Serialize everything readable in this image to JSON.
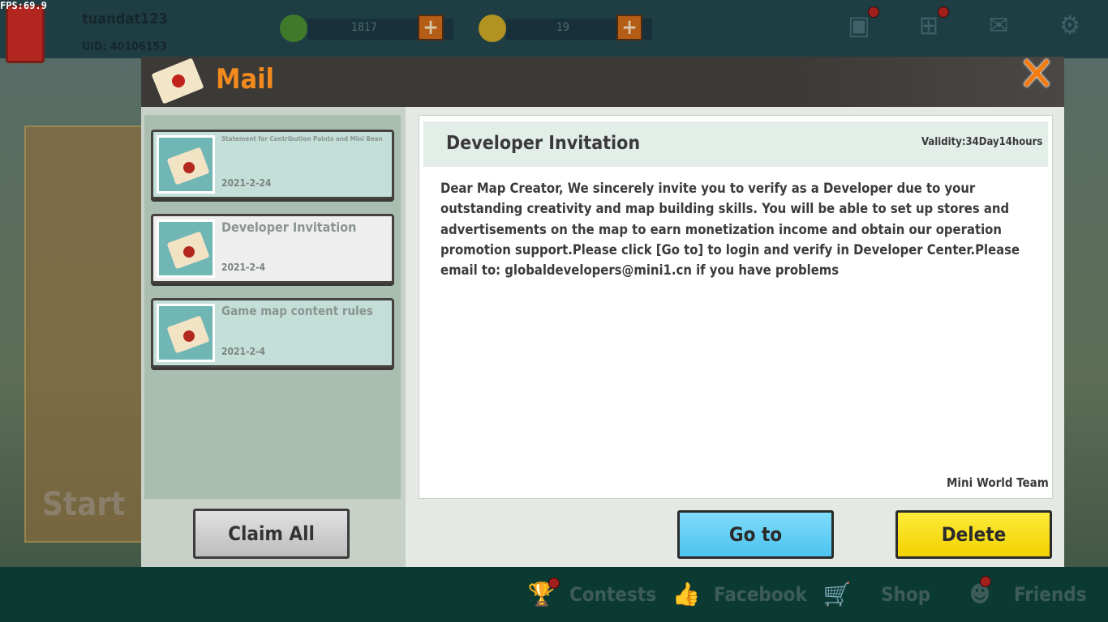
{
  "hud": {
    "fps": "FPS:69.9",
    "username": "tuandat123",
    "uid": "UID: 40106153",
    "currencies": [
      {
        "icon": "mini-coin-green-icon",
        "value": "1817",
        "color": "#3f7a2b"
      },
      {
        "icon": "mini-bean-gold-icon",
        "value": "19",
        "color": "#b39224"
      }
    ],
    "top_icons": [
      "chest-icon",
      "gift-icon",
      "mail-icon",
      "gear-icon"
    ]
  },
  "background": {
    "start_label": "Start"
  },
  "bottom_nav": [
    {
      "label": "Contests",
      "icon": "trophy-icon",
      "badge": true
    },
    {
      "label": "Facebook",
      "icon": "thumbs-up-icon",
      "badge": false
    },
    {
      "label": "Shop",
      "icon": "cart-icon",
      "badge": false
    },
    {
      "label": "Friends",
      "icon": "friends-icon",
      "badge": true
    }
  ],
  "mail": {
    "title": "Mail",
    "close_icon": "close-icon",
    "items": [
      {
        "title": "Statement for Contribution Points and Mini Bean",
        "date": "2021-2-24",
        "selected": false
      },
      {
        "title": "Developer Invitation",
        "date": "2021-2-4",
        "selected": true
      },
      {
        "title": "Game map content rules",
        "date": "2021-2-4",
        "selected": false
      }
    ],
    "claim_all": "Claim All",
    "detail": {
      "title": "Developer Invitation",
      "validity": "Validity:34Day14hours",
      "body": "Dear Map Creator, We sincerely invite you to verify as a Developer due to your outstanding creativity and map building skills. You will be able to set up stores and advertisements on the map to earn monetization income and obtain our operation promotion support.Please click [Go to] to login and verify in Developer Center.Please email to: globaldevelopers@mini1.cn if you have problems",
      "sender": "Mini World Team"
    },
    "goto": "Go to",
    "delete": "Delete",
    "colors": {
      "title": "#f28a1e",
      "goto": "#5ccff5",
      "delete": "#f7df0e",
      "selected_item": "#eeeeee",
      "item": "#c4ded8"
    }
  }
}
